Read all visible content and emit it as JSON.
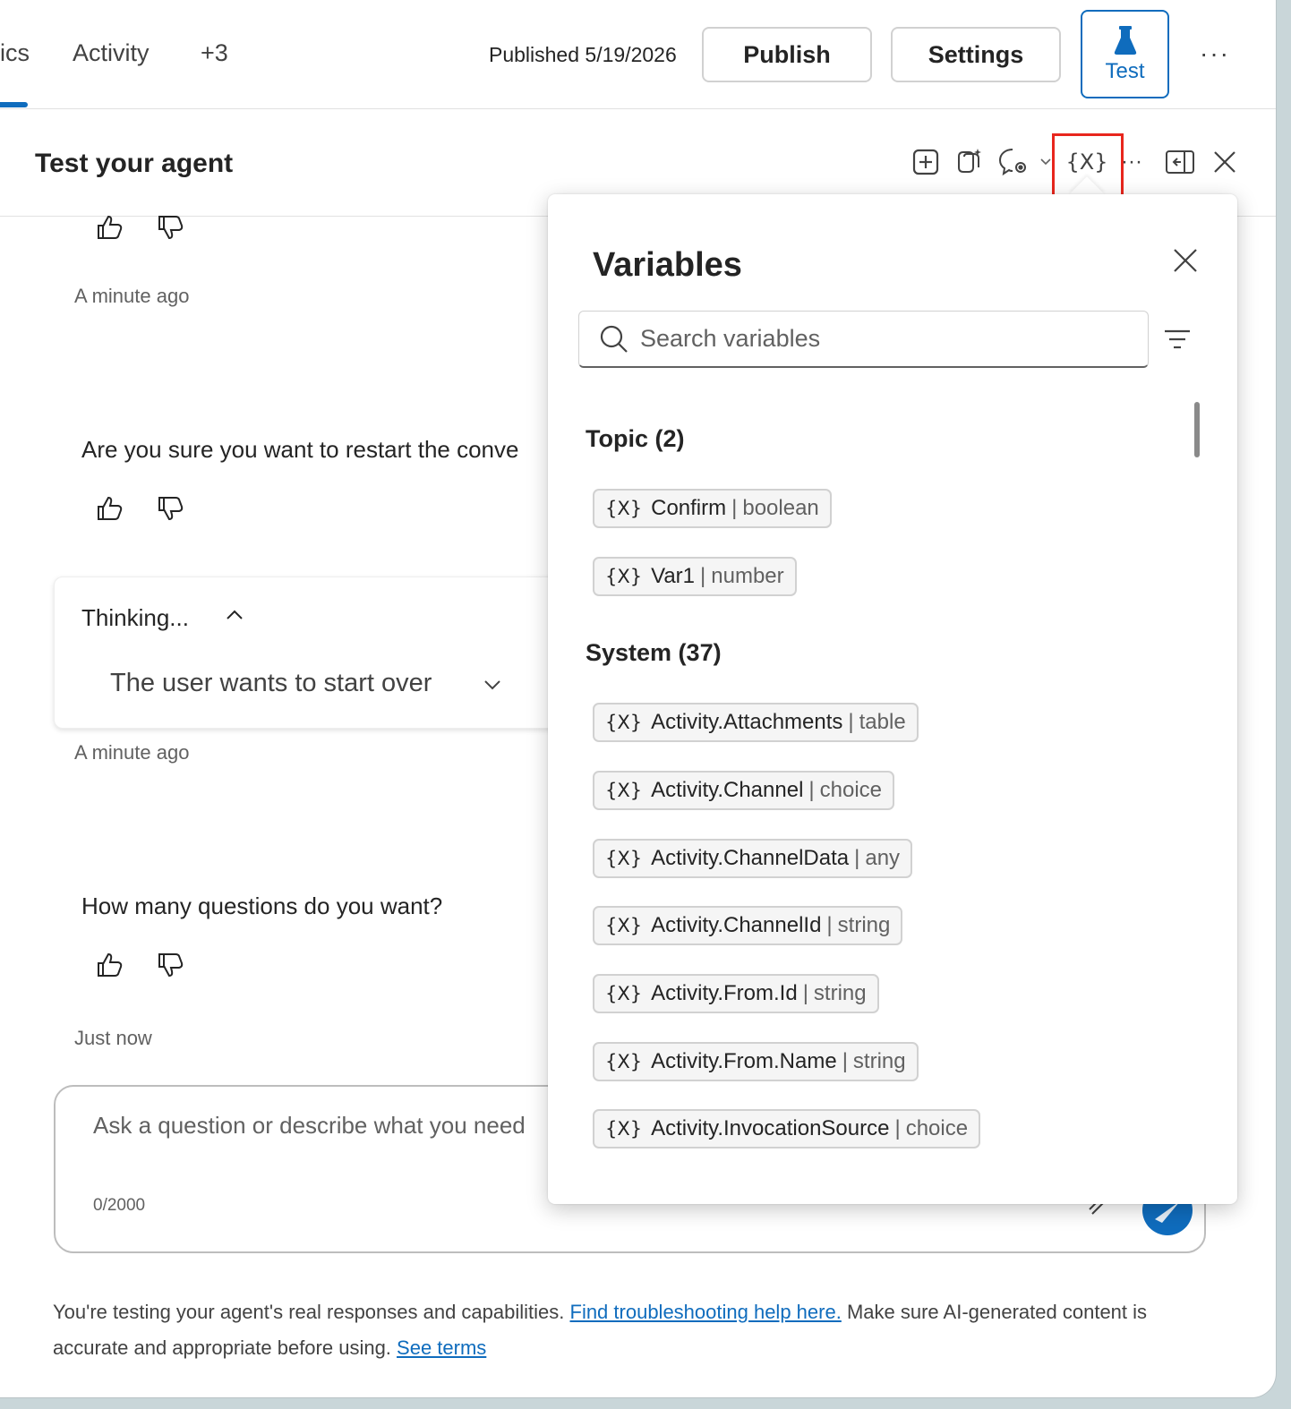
{
  "topbar": {
    "tabs": [
      {
        "label": "ics"
      },
      {
        "label": "Activity"
      },
      {
        "label": "+3"
      }
    ],
    "published": "Published 5/19/2026",
    "publish_label": "Publish",
    "settings_label": "Settings",
    "test_label": "Test",
    "more_label": "···"
  },
  "pane": {
    "title": "Test your agent"
  },
  "chat": {
    "timestamp1": "A minute ago",
    "message1": "Are you sure you want to restart the conve",
    "thinking_label": "Thinking...",
    "thinking_detail": "The user wants to start over",
    "timestamp2": "A minute ago",
    "message2": "How many questions do you want?",
    "timestamp3": "Just now",
    "input_placeholder": "Ask a question or describe what you need",
    "char_count": "0/2000"
  },
  "disclaimer": {
    "text1": "You're testing your agent's real responses and capabilities. ",
    "link1": "Find troubleshooting help here.",
    "text2": " Make sure AI-generated content is accurate and appropriate before using. ",
    "link2": "See terms"
  },
  "variables": {
    "title": "Variables",
    "search_placeholder": "Search variables",
    "sections": [
      {
        "heading": "Topic (2)",
        "items": [
          {
            "name": "Confirm",
            "type": "boolean"
          },
          {
            "name": "Var1",
            "type": "number"
          }
        ]
      },
      {
        "heading": "System (37)",
        "items": [
          {
            "name": "Activity.Attachments",
            "type": "table"
          },
          {
            "name": "Activity.Channel",
            "type": "choice"
          },
          {
            "name": "Activity.ChannelData",
            "type": "any"
          },
          {
            "name": "Activity.ChannelId",
            "type": "string"
          },
          {
            "name": "Activity.From.Id",
            "type": "string"
          },
          {
            "name": "Activity.From.Name",
            "type": "string"
          },
          {
            "name": "Activity.InvocationSource",
            "type": "choice"
          }
        ]
      }
    ],
    "icon_glyph": "{X}",
    "separator": "|"
  },
  "colors": {
    "accent": "#0f6cbd",
    "highlight": "#e8261d"
  }
}
